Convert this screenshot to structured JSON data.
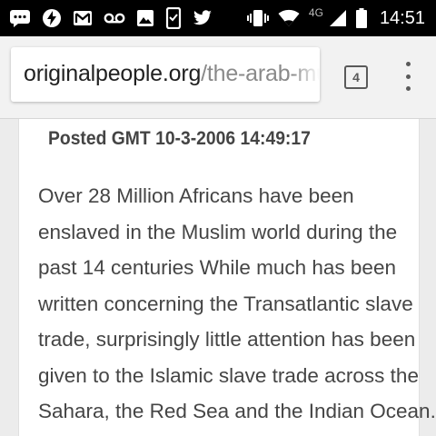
{
  "status_bar": {
    "time": "14:51",
    "network": "4G",
    "icons_left": [
      "messaging-icon",
      "bolt-app-icon",
      "gmail-icon",
      "voicemail-icon",
      "gallery-icon",
      "screenshot-icon",
      "twitter-icon"
    ],
    "icons_right": [
      "vibrate-icon",
      "wifi-icon",
      "cell-signal-icon",
      "battery-icon"
    ]
  },
  "browser": {
    "url_domain": "originalpeople.org",
    "url_path": "/the-arab-musli",
    "tab_count": "4"
  },
  "content": {
    "posted": "Posted GMT 10-3-2006 14:49:17",
    "article_lines": [
      "Over 28 Million Africans have been",
      "enslaved in the Muslim world during the",
      "past 14 centuries While much has been",
      "written concerning the Transatlantic slave",
      "trade, surprisingly little attention has been",
      "given to the Islamic slave trade across the",
      "Sahara, the Red Sea and the Indian Ocean."
    ]
  }
}
